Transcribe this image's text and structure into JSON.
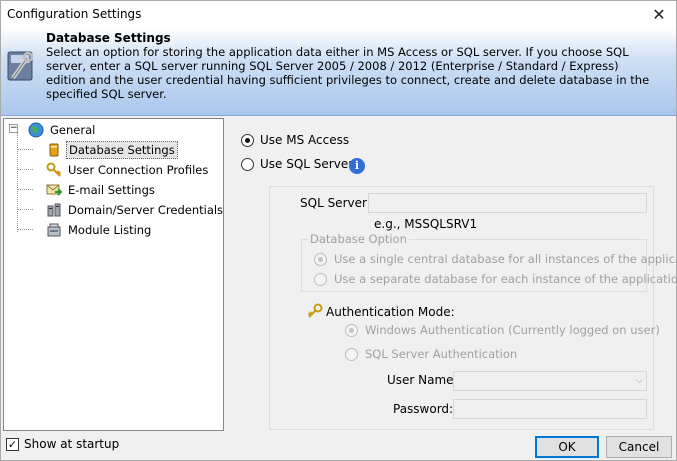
{
  "window": {
    "title": "Configuration Settings",
    "close_glyph": "✕"
  },
  "banner": {
    "heading": "Database Settings",
    "text": "Select an option for storing the application data either in MS Access or SQL server. If you choose SQL server, enter a SQL server running SQL Server 2005 / 2008 / 2012 (Enterprise / Standard / Express) edition and the user credential having sufficient privileges to connect, create and delete database in the specified SQL server.",
    "icon": "tools-icon"
  },
  "tree": {
    "root": {
      "label": "General",
      "icon": "globe-icon",
      "expander": "−"
    },
    "items": [
      {
        "label": "Database Settings",
        "icon": "database-icon",
        "selected": true
      },
      {
        "label": "User Connection Profiles",
        "icon": "key-icon"
      },
      {
        "label": "E-mail Settings",
        "icon": "email-icon"
      },
      {
        "label": "Domain/Server Credentials",
        "icon": "server-icon"
      },
      {
        "label": "Module Listing",
        "icon": "module-icon"
      }
    ]
  },
  "storage": {
    "ms_access_label": "Use MS Access",
    "sql_server_label": "Use SQL Server",
    "selected": "ms_access",
    "info_glyph": "i"
  },
  "sql": {
    "server_label": "SQL Server:",
    "server_value": "",
    "server_example": "e.g., MSSQLSRV1",
    "db_option_legend": "Database Option",
    "db_option_central": "Use a single central database for all instances of the application",
    "db_option_separate": "Use a separate database for each instance of the application",
    "auth_mode_label": "Authentication Mode:",
    "auth_windows": "Windows Authentication (Currently logged on user)",
    "auth_sql": "SQL Server Authentication",
    "username_label": "User Name:",
    "username_value": "",
    "password_label": "Password:",
    "password_value": ""
  },
  "footer": {
    "show_at_startup": "Show at startup",
    "show_at_startup_checked": true,
    "ok": "OK",
    "cancel": "Cancel"
  }
}
